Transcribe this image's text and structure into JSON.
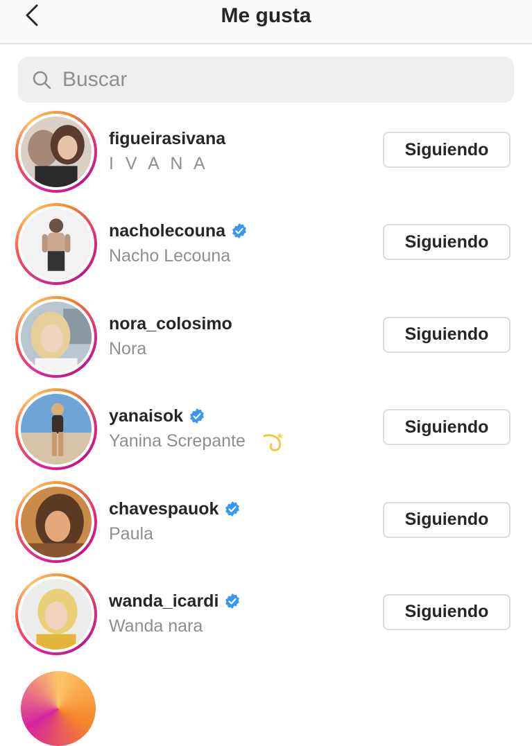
{
  "header": {
    "title": "Me gusta",
    "back_icon": "chevron-left-icon"
  },
  "search": {
    "placeholder": "Buscar",
    "icon": "search-icon"
  },
  "users": [
    {
      "username": "figueirasivana",
      "fullname": "I V A N A",
      "verified": false,
      "button": "Siguiendo",
      "photo_colors": [
        "#d9cfc7",
        "#5a3b2c"
      ]
    },
    {
      "username": "nacholecouna",
      "fullname": "Nacho Lecouna",
      "verified": true,
      "button": "Siguiendo",
      "photo_colors": [
        "#f2f2f2",
        "#4a4a4a"
      ]
    },
    {
      "username": "nora_colosimo",
      "fullname": "Nora",
      "verified": false,
      "button": "Siguiendo",
      "photo_colors": [
        "#b9c6cf",
        "#e7cf9a"
      ]
    },
    {
      "username": "yanaisok",
      "fullname": "Yanina Screpante",
      "verified": true,
      "button": "Siguiendo",
      "photo_colors": [
        "#6fa4d6",
        "#c99a6a"
      ],
      "emoji": "dizzy-icon"
    },
    {
      "username": "chavespauok",
      "fullname": "Paula",
      "verified": true,
      "button": "Siguiendo",
      "photo_colors": [
        "#c98a4a",
        "#5b3a24"
      ]
    },
    {
      "username": "wanda_icardi",
      "fullname": "Wanda nara",
      "verified": true,
      "button": "Siguiendo",
      "photo_colors": [
        "#ececea",
        "#e8cf78"
      ]
    }
  ],
  "colors": {
    "verified": "#3897f0",
    "text": "#262626",
    "secondary": "#8e8e8e",
    "border": "#dbdbdb"
  }
}
